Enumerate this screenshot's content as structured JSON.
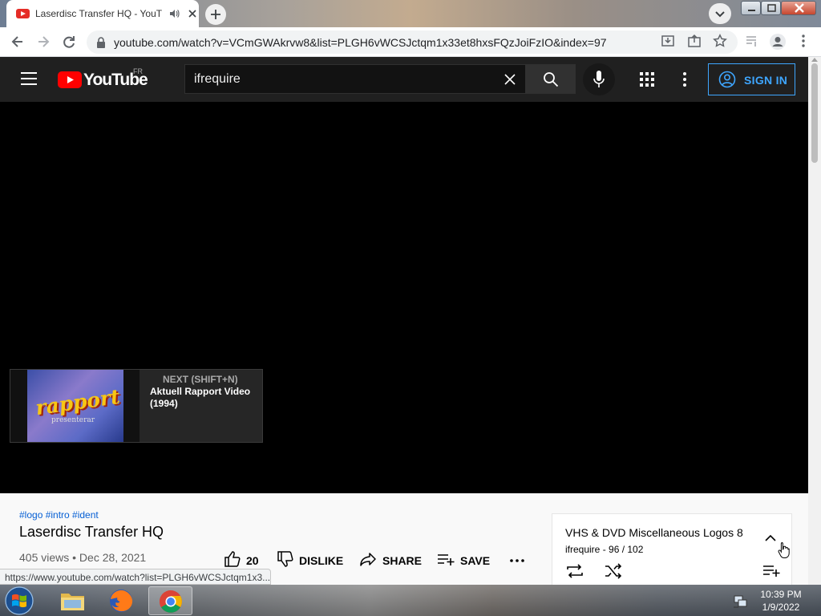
{
  "browser": {
    "tab_title": "Laserdisc Transfer HQ - YouTube",
    "url": "youtube.com/watch?v=VCmGWAkrvw8&list=PLGH6vWCSJctqm1x33et8hxsFQzJoiFzIO&index=97",
    "status_url": "https://www.youtube.com/watch?list=PLGH6vWCSJctqm1x3..."
  },
  "youtube": {
    "logo_text": "YouTube",
    "region": "FR",
    "search_value": "ifrequire",
    "sign_in": "SIGN IN"
  },
  "player": {
    "next_label": "NEXT (SHIFT+N)",
    "next_title": "Aktuell Rapport Video (1994)",
    "thumb_text": "rapport",
    "thumb_subtext": "presenterar"
  },
  "video": {
    "hashtags": "#logo #intro #ident",
    "title": "Laserdisc Transfer HQ",
    "meta": "405 views • Dec 28, 2021",
    "likes": "20",
    "dislike": "DISLIKE",
    "share": "SHARE",
    "save": "SAVE"
  },
  "playlist": {
    "title": "VHS & DVD Miscellaneous Logos 8",
    "subtitle": "ifrequire - 96 / 102"
  },
  "taskbar": {
    "time": "10:39 PM",
    "date": "1/9/2022"
  },
  "colors": {
    "accent_blue": "#3ea6ff",
    "yt_red": "#ff0000"
  }
}
